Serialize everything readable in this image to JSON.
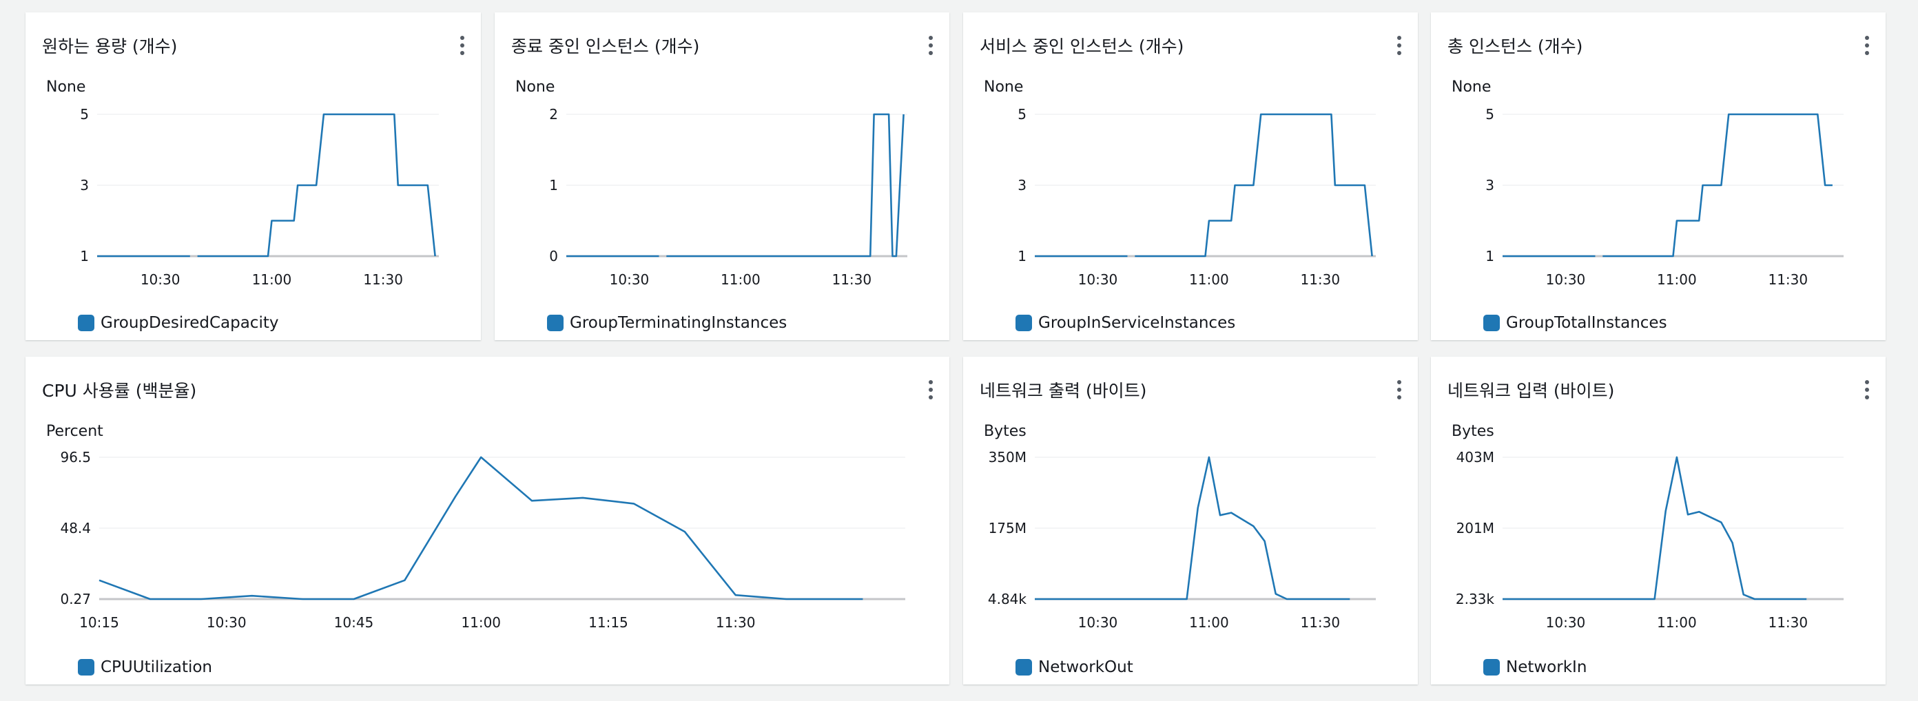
{
  "panels": [
    {
      "title": "원하는 용량 (개수)",
      "unit": "None",
      "legend": "GroupDesiredCapacity",
      "menu_icon": "more-vertical-icon",
      "color": "#1f77b4",
      "chart_data": {
        "type": "line",
        "x_axis": "time",
        "xlim": [
          "10:13",
          "11:45"
        ],
        "xticks": [
          "10:30",
          "11:00",
          "11:30"
        ],
        "yticks": [
          "1",
          "3",
          "5"
        ],
        "ylim": [
          1,
          5
        ],
        "series": [
          {
            "name": "GroupDesiredCapacity",
            "segments": [
              [
                [
                  "10:13",
                  1
                ],
                [
                  "10:38",
                  1
                ]
              ],
              [
                [
                  "10:40",
                  1
                ],
                [
                  "10:59",
                  1
                ],
                [
                  "11:00",
                  2
                ],
                [
                  "11:06",
                  2
                ],
                [
                  "11:07",
                  3
                ],
                [
                  "11:12",
                  3
                ],
                [
                  "11:14",
                  5
                ],
                [
                  "11:33",
                  5
                ],
                [
                  "11:34",
                  3
                ],
                [
                  "11:42",
                  3
                ],
                [
                  "11:43",
                  2
                ],
                [
                  "11:44",
                  1
                ]
              ]
            ]
          }
        ]
      }
    },
    {
      "title": "종료 중인 인스턴스 (개수)",
      "unit": "None",
      "legend": "GroupTerminatingInstances",
      "menu_icon": "more-vertical-icon",
      "color": "#1f77b4",
      "chart_data": {
        "type": "line",
        "x_axis": "time",
        "xlim": [
          "10:13",
          "11:45"
        ],
        "xticks": [
          "10:30",
          "11:00",
          "11:30"
        ],
        "yticks": [
          "0",
          "1",
          "2"
        ],
        "ylim": [
          0,
          2
        ],
        "series": [
          {
            "name": "GroupTerminatingInstances",
            "segments": [
              [
                [
                  "10:13",
                  0
                ],
                [
                  "10:38",
                  0
                ]
              ],
              [
                [
                  "10:40",
                  0
                ],
                [
                  "11:35",
                  0
                ],
                [
                  "11:36",
                  2
                ],
                [
                  "11:40",
                  2
                ],
                [
                  "11:41",
                  0
                ],
                [
                  "11:42",
                  0
                ],
                [
                  "11:43",
                  1
                ],
                [
                  "11:44",
                  2
                ]
              ]
            ]
          }
        ]
      }
    },
    {
      "title": "서비스 중인 인스턴스 (개수)",
      "unit": "None",
      "legend": "GroupInServiceInstances",
      "menu_icon": "more-vertical-icon",
      "color": "#1f77b4",
      "chart_data": {
        "type": "line",
        "x_axis": "time",
        "xlim": [
          "10:13",
          "11:45"
        ],
        "xticks": [
          "10:30",
          "11:00",
          "11:30"
        ],
        "yticks": [
          "1",
          "3",
          "5"
        ],
        "ylim": [
          1,
          5
        ],
        "series": [
          {
            "name": "GroupInServiceInstances",
            "segments": [
              [
                [
                  "10:13",
                  1
                ],
                [
                  "10:38",
                  1
                ]
              ],
              [
                [
                  "10:40",
                  1
                ],
                [
                  "10:59",
                  1
                ],
                [
                  "11:00",
                  2
                ],
                [
                  "11:06",
                  2
                ],
                [
                  "11:07",
                  3
                ],
                [
                  "11:12",
                  3
                ],
                [
                  "11:14",
                  5
                ],
                [
                  "11:33",
                  5
                ],
                [
                  "11:34",
                  3
                ],
                [
                  "11:42",
                  3
                ],
                [
                  "11:43",
                  2
                ],
                [
                  "11:44",
                  1
                ]
              ]
            ]
          }
        ]
      }
    },
    {
      "title": "총 인스턴스 (개수)",
      "unit": "None",
      "legend": "GroupTotalInstances",
      "menu_icon": "more-vertical-icon",
      "color": "#1f77b4",
      "chart_data": {
        "type": "line",
        "x_axis": "time",
        "xlim": [
          "10:13",
          "11:45"
        ],
        "xticks": [
          "10:30",
          "11:00",
          "11:30"
        ],
        "yticks": [
          "1",
          "3",
          "5"
        ],
        "ylim": [
          1,
          5
        ],
        "series": [
          {
            "name": "GroupTotalInstances",
            "segments": [
              [
                [
                  "10:13",
                  1
                ],
                [
                  "10:38",
                  1
                ]
              ],
              [
                [
                  "10:40",
                  1
                ],
                [
                  "10:59",
                  1
                ],
                [
                  "11:00",
                  2
                ],
                [
                  "11:06",
                  2
                ],
                [
                  "11:07",
                  3
                ],
                [
                  "11:12",
                  3
                ],
                [
                  "11:14",
                  5
                ],
                [
                  "11:38",
                  5
                ],
                [
                  "11:40",
                  3
                ],
                [
                  "11:42",
                  3
                ]
              ]
            ]
          }
        ]
      }
    },
    {
      "title": "CPU 사용률 (백분율)",
      "unit": "Percent",
      "legend": "CPUUtilization",
      "menu_icon": "more-vertical-icon",
      "color": "#1f77b4",
      "chart_data": {
        "type": "line",
        "x_axis": "time",
        "xlim": [
          "10:15",
          "11:50"
        ],
        "xticks": [
          "10:15",
          "10:30",
          "10:45",
          "11:00",
          "11:15",
          "11:30"
        ],
        "yticks": [
          "0.27",
          "48.4",
          "96.5"
        ],
        "ylim": [
          0.27,
          96.5
        ],
        "series": [
          {
            "name": "CPUUtilization",
            "segments": [
              [
                [
                  "10:15",
                  13
                ],
                [
                  "10:21",
                  0.27
                ],
                [
                  "10:27",
                  0.27
                ],
                [
                  "10:33",
                  2.5
                ],
                [
                  "10:39",
                  0.27
                ],
                [
                  "10:45",
                  0.27
                ],
                [
                  "10:51",
                  13
                ],
                [
                  "10:57",
                  70
                ],
                [
                  "11:00",
                  96.5
                ],
                [
                  "11:06",
                  67
                ],
                [
                  "11:12",
                  69
                ],
                [
                  "11:18",
                  65
                ],
                [
                  "11:24",
                  46
                ],
                [
                  "11:30",
                  3
                ],
                [
                  "11:36",
                  0.27
                ],
                [
                  "11:42",
                  0.27
                ],
                [
                  "11:45",
                  0.27
                ]
              ]
            ]
          }
        ]
      }
    },
    {
      "title": "네트워크 출력 (바이트)",
      "unit": "Bytes",
      "legend": "NetworkOut",
      "menu_icon": "more-vertical-icon",
      "color": "#1f77b4",
      "chart_data": {
        "type": "line",
        "x_axis": "time",
        "xlim": [
          "10:13",
          "11:45"
        ],
        "xticks": [
          "10:30",
          "11:00",
          "11:30"
        ],
        "yticks": [
          "4.84k",
          "175M",
          "350M"
        ],
        "ylim": [
          0.00484,
          350
        ],
        "y_unit": "M",
        "series": [
          {
            "name": "NetworkOut",
            "segments": [
              [
                [
                  "10:13",
                  0.00484
                ],
                [
                  "10:48",
                  0.00484
                ],
                [
                  "10:54",
                  0.00484
                ],
                [
                  "10:57",
                  225
                ],
                [
                  "11:00",
                  350
                ],
                [
                  "11:03",
                  207
                ],
                [
                  "11:06",
                  213
                ],
                [
                  "11:12",
                  180
                ],
                [
                  "11:15",
                  143
                ],
                [
                  "11:18",
                  13
                ],
                [
                  "11:21",
                  0.00484
                ],
                [
                  "11:27",
                  0.00484
                ],
                [
                  "11:38",
                  0.00484
                ]
              ]
            ]
          }
        ]
      }
    },
    {
      "title": "네트워크 입력 (바이트)",
      "unit": "Bytes",
      "legend": "NetworkIn",
      "menu_icon": "more-vertical-icon",
      "color": "#1f77b4",
      "chart_data": {
        "type": "line",
        "x_axis": "time",
        "xlim": [
          "10:13",
          "11:45"
        ],
        "xticks": [
          "10:30",
          "11:00",
          "11:30"
        ],
        "yticks": [
          "2.33k",
          "201M",
          "403M"
        ],
        "ylim": [
          0.00233,
          403
        ],
        "y_unit": "M",
        "series": [
          {
            "name": "NetworkIn",
            "segments": [
              [
                [
                  "10:13",
                  0.00233
                ],
                [
                  "10:50",
                  0.00233
                ],
                [
                  "10:54",
                  0.00233
                ],
                [
                  "10:57",
                  250
                ],
                [
                  "11:00",
                  403
                ],
                [
                  "11:03",
                  240
                ],
                [
                  "11:06",
                  248
                ],
                [
                  "11:12",
                  218
                ],
                [
                  "11:15",
                  160
                ],
                [
                  "11:18",
                  13
                ],
                [
                  "11:21",
                  0.00233
                ],
                [
                  "11:27",
                  0.00233
                ],
                [
                  "11:35",
                  0.00233
                ]
              ]
            ]
          }
        ]
      }
    }
  ]
}
